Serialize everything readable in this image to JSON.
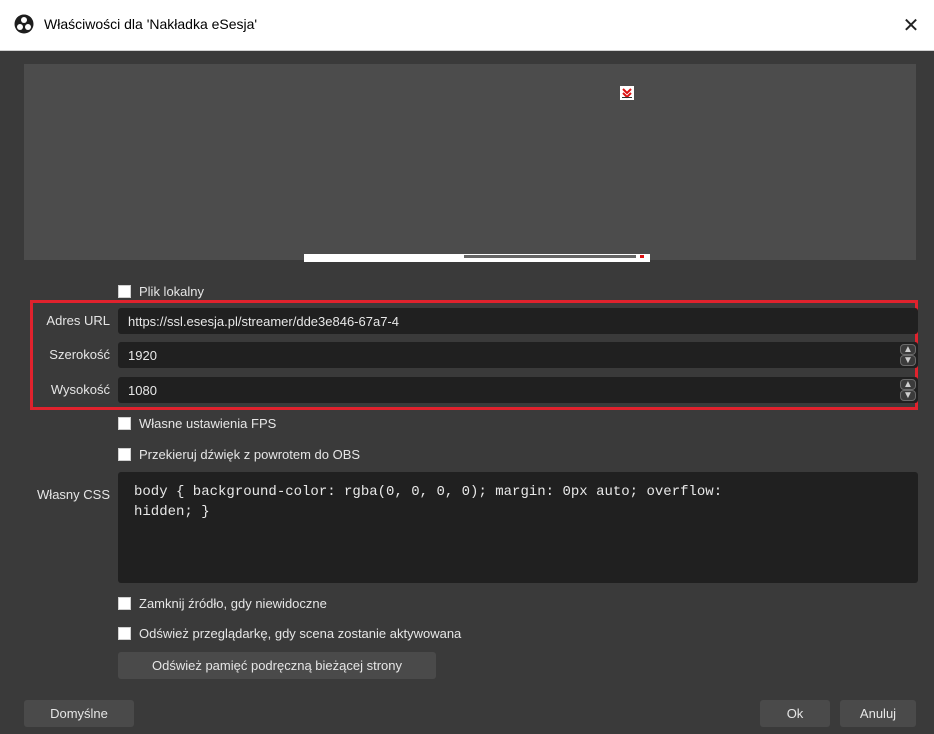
{
  "window": {
    "title": "Właściwości dla 'Nakładka eSesja'",
    "close_glyph": "✕",
    "app_icon": "obs-logo-icon"
  },
  "form": {
    "local_file_label": "Plik lokalny",
    "url_label": "Adres URL",
    "url_value": "https://ssl.esesja.pl/streamer/dde3e846-67a7-4",
    "width_label": "Szerokość",
    "width_value": "1920",
    "height_label": "Wysokość",
    "height_value": "1080",
    "fps_label": "Własne ustawienia FPS",
    "audio_label": "Przekieruj dźwięk z powrotem do OBS",
    "css_label": "Własny CSS",
    "css_value": "body { background-color: rgba(0, 0, 0, 0); margin: 0px auto; overflow:\nhidden; }",
    "shutdown_label": "Zamknij źródło, gdy niewidoczne",
    "refresh_label": "Odśwież przeglądarkę, gdy scena zostanie aktywowana",
    "refresh_cache_button": "Odśwież pamięć podręczną bieżącej strony"
  },
  "footer": {
    "defaults_button": "Domyślne",
    "ok_button": "Ok",
    "cancel_button": "Anuluj"
  },
  "colors": {
    "background": "#3a3a3a",
    "field": "#202020",
    "highlight": "#e0222d"
  }
}
